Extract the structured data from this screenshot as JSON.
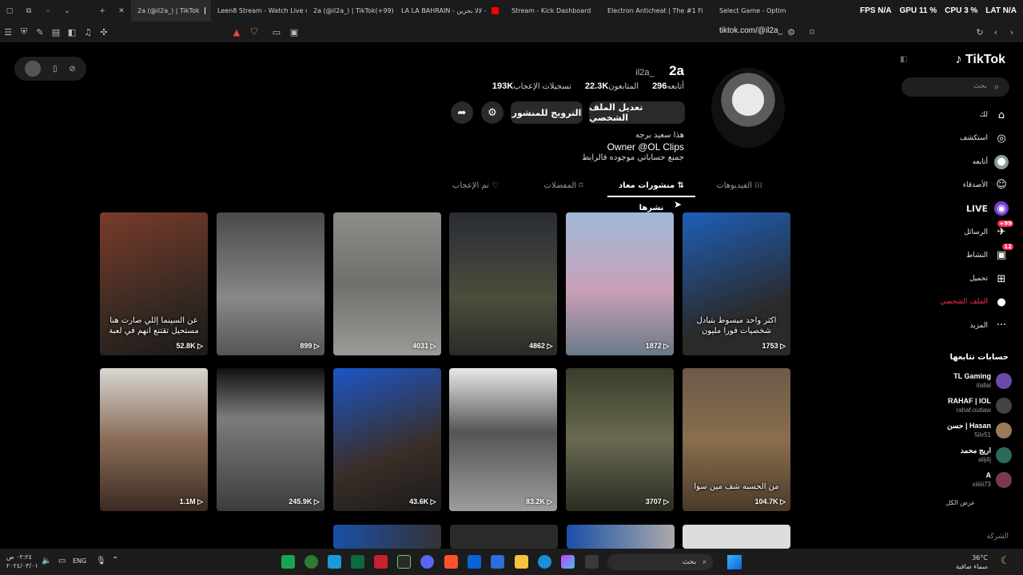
{
  "browser": {
    "tabs": [
      {
        "label": "2a (@il2a_) | TikTok",
        "color": "#ffffff",
        "active": true
      },
      {
        "label": "Leen8 Stream - Watch Live on",
        "color": "#53fc18",
        "active": false
      },
      {
        "label": "2a (@il2a_) | TikTok(+99)",
        "color": "#ffffff",
        "active": false
      },
      {
        "label": "LA LA BAHRAIN - لالا بحرين -",
        "color": "#ff0000",
        "active": false
      },
      {
        "label": "Stream - Kick Dashboard",
        "color": "#53fc18",
        "active": false
      },
      {
        "label": "Electron Anticheat | The #1 Fi",
        "color": "#9b9b9b",
        "active": false
      },
      {
        "label": "Select Game - Optim",
        "color": "#9b9b9b",
        "active": false
      }
    ],
    "url": "tiktok.com/@il2a_",
    "hud": {
      "fps": "FPS N/A",
      "gpu": "GPU 11 %",
      "cpu": "CPU 3 %",
      "lat": "LAT N/A"
    }
  },
  "profile": {
    "display_name": "2a",
    "username": "il2a_",
    "stats": [
      {
        "value": "296",
        "label": "أتابعه"
      },
      {
        "value": "22.3K",
        "label": "المتابعون"
      },
      {
        "value": "193K",
        "label": "تسجيلات الإعجاب"
      }
    ],
    "buttons": {
      "edit": "تعديل الملف الشخصي",
      "promote": "الترويج للمنشور"
    },
    "bio": [
      "هذا سعيد برجه",
      "Owner @OL Clips",
      "جمنع حساباتي موجوده فالرابط"
    ],
    "tabs": [
      "الفيديوهات",
      "منشورات معاد نشرها",
      "المفضلات",
      "تم الإعجاب"
    ]
  },
  "videos": [
    {
      "views": "52.8K",
      "caption": "عن السينما إللي صارت هنا مستحيل تقتنع انهم في لعبة",
      "bg": "linear-gradient(160deg,#7a3b2a,#3a2a22 60%,#1a1a1a)"
    },
    {
      "views": "899",
      "caption": "",
      "bg": "linear-gradient(180deg,#4a4a4a,#888 60%,#555)"
    },
    {
      "views": "4031",
      "caption": "",
      "bg": "linear-gradient(180deg,#8a8d88,#6f706c 50%,#9a9a96)"
    },
    {
      "views": "4862",
      "caption": "",
      "bg": "linear-gradient(180deg,#2a2c36,#4a4e3a 60%,#2a2a2a)"
    },
    {
      "views": "1872",
      "caption": "",
      "bg": "linear-gradient(180deg,#9fb9d6,#c9a0b8 55%,#6a7a88)"
    },
    {
      "views": "1753",
      "caption": "اكثر واحد مبسوط بتبادل شخصيات فورا مليون",
      "bg": "linear-gradient(160deg,#1e5fb8,#2a2a2a 70%)"
    },
    {
      "views": "1.1M",
      "caption": "",
      "bg": "linear-gradient(180deg,#d9d6d2,#8a6d58 50%,#3a2a22)"
    },
    {
      "views": "245.9K",
      "caption": "",
      "bg": "linear-gradient(180deg,#111,#7c7c7c 35%,#3d3d3d)"
    },
    {
      "views": "43.6K",
      "caption": "",
      "bg": "linear-gradient(160deg,#1b56c7,#3a2e28 60%,#1a1a1a)"
    },
    {
      "views": "83.2K",
      "caption": "",
      "bg": "linear-gradient(180deg,#e8e8e8,#555 45%,#9d9d9d)"
    },
    {
      "views": "3707",
      "caption": "",
      "bg": "linear-gradient(180deg,#3a3d2a,#6a6a52 50%,#2c2d22)"
    },
    {
      "views": "104.7K",
      "caption": "من الحسبه شف مين سوا",
      "bg": "linear-gradient(180deg,#6b5a48,#8a6e4e 50%,#4a3a2a)"
    }
  ],
  "sidebar": {
    "logo": "TikTok",
    "search_placeholder": "بحث",
    "nav": [
      {
        "label": "لك",
        "icon": "home-icon",
        "glyph": "⌂"
      },
      {
        "label": "استكشف",
        "icon": "compass-icon",
        "glyph": "◎"
      },
      {
        "label": "أتابعه",
        "icon": "following-icon",
        "glyph": "●"
      },
      {
        "label": "الأصدقاء",
        "icon": "friends-icon",
        "glyph": "☺"
      },
      {
        "label": "LIVE",
        "icon": "live-icon",
        "glyph": "◉"
      },
      {
        "label": "الرسائل",
        "icon": "messages-icon",
        "glyph": "✈",
        "badge": "+99"
      },
      {
        "label": "النشاط",
        "icon": "activity-icon",
        "glyph": "▣",
        "badge": "12"
      },
      {
        "label": "تحميل",
        "icon": "upload-icon",
        "glyph": "⊞"
      },
      {
        "label": "الملف الشخصي",
        "icon": "profile-icon",
        "glyph": "●"
      },
      {
        "label": "المزيد",
        "icon": "more-icon",
        "glyph": "···"
      }
    ],
    "following_title": "حسابات تتابعها",
    "following": [
      {
        "name": "TL Gaming",
        "handle": "itallal"
      },
      {
        "name": "RAHAF | IOL",
        "handle": "rahaf.outlaw"
      },
      {
        "name": "حسن | Hasan",
        "handle": "5iiv51"
      },
      {
        "name": "اريج محمد",
        "handle": "alij4j"
      },
      {
        "name": "A",
        "handle": "xiiiiii73"
      }
    ],
    "see_all": "عرض الكل",
    "company": "الشركة"
  },
  "taskbar": {
    "time": "٠٢:٢٤ ص",
    "date": "٢٠٢٤/٠٣/٠١",
    "lang": "ENG",
    "search": "بحث",
    "weather_temp": "36°C",
    "weather_desc": "سماء صافية"
  }
}
